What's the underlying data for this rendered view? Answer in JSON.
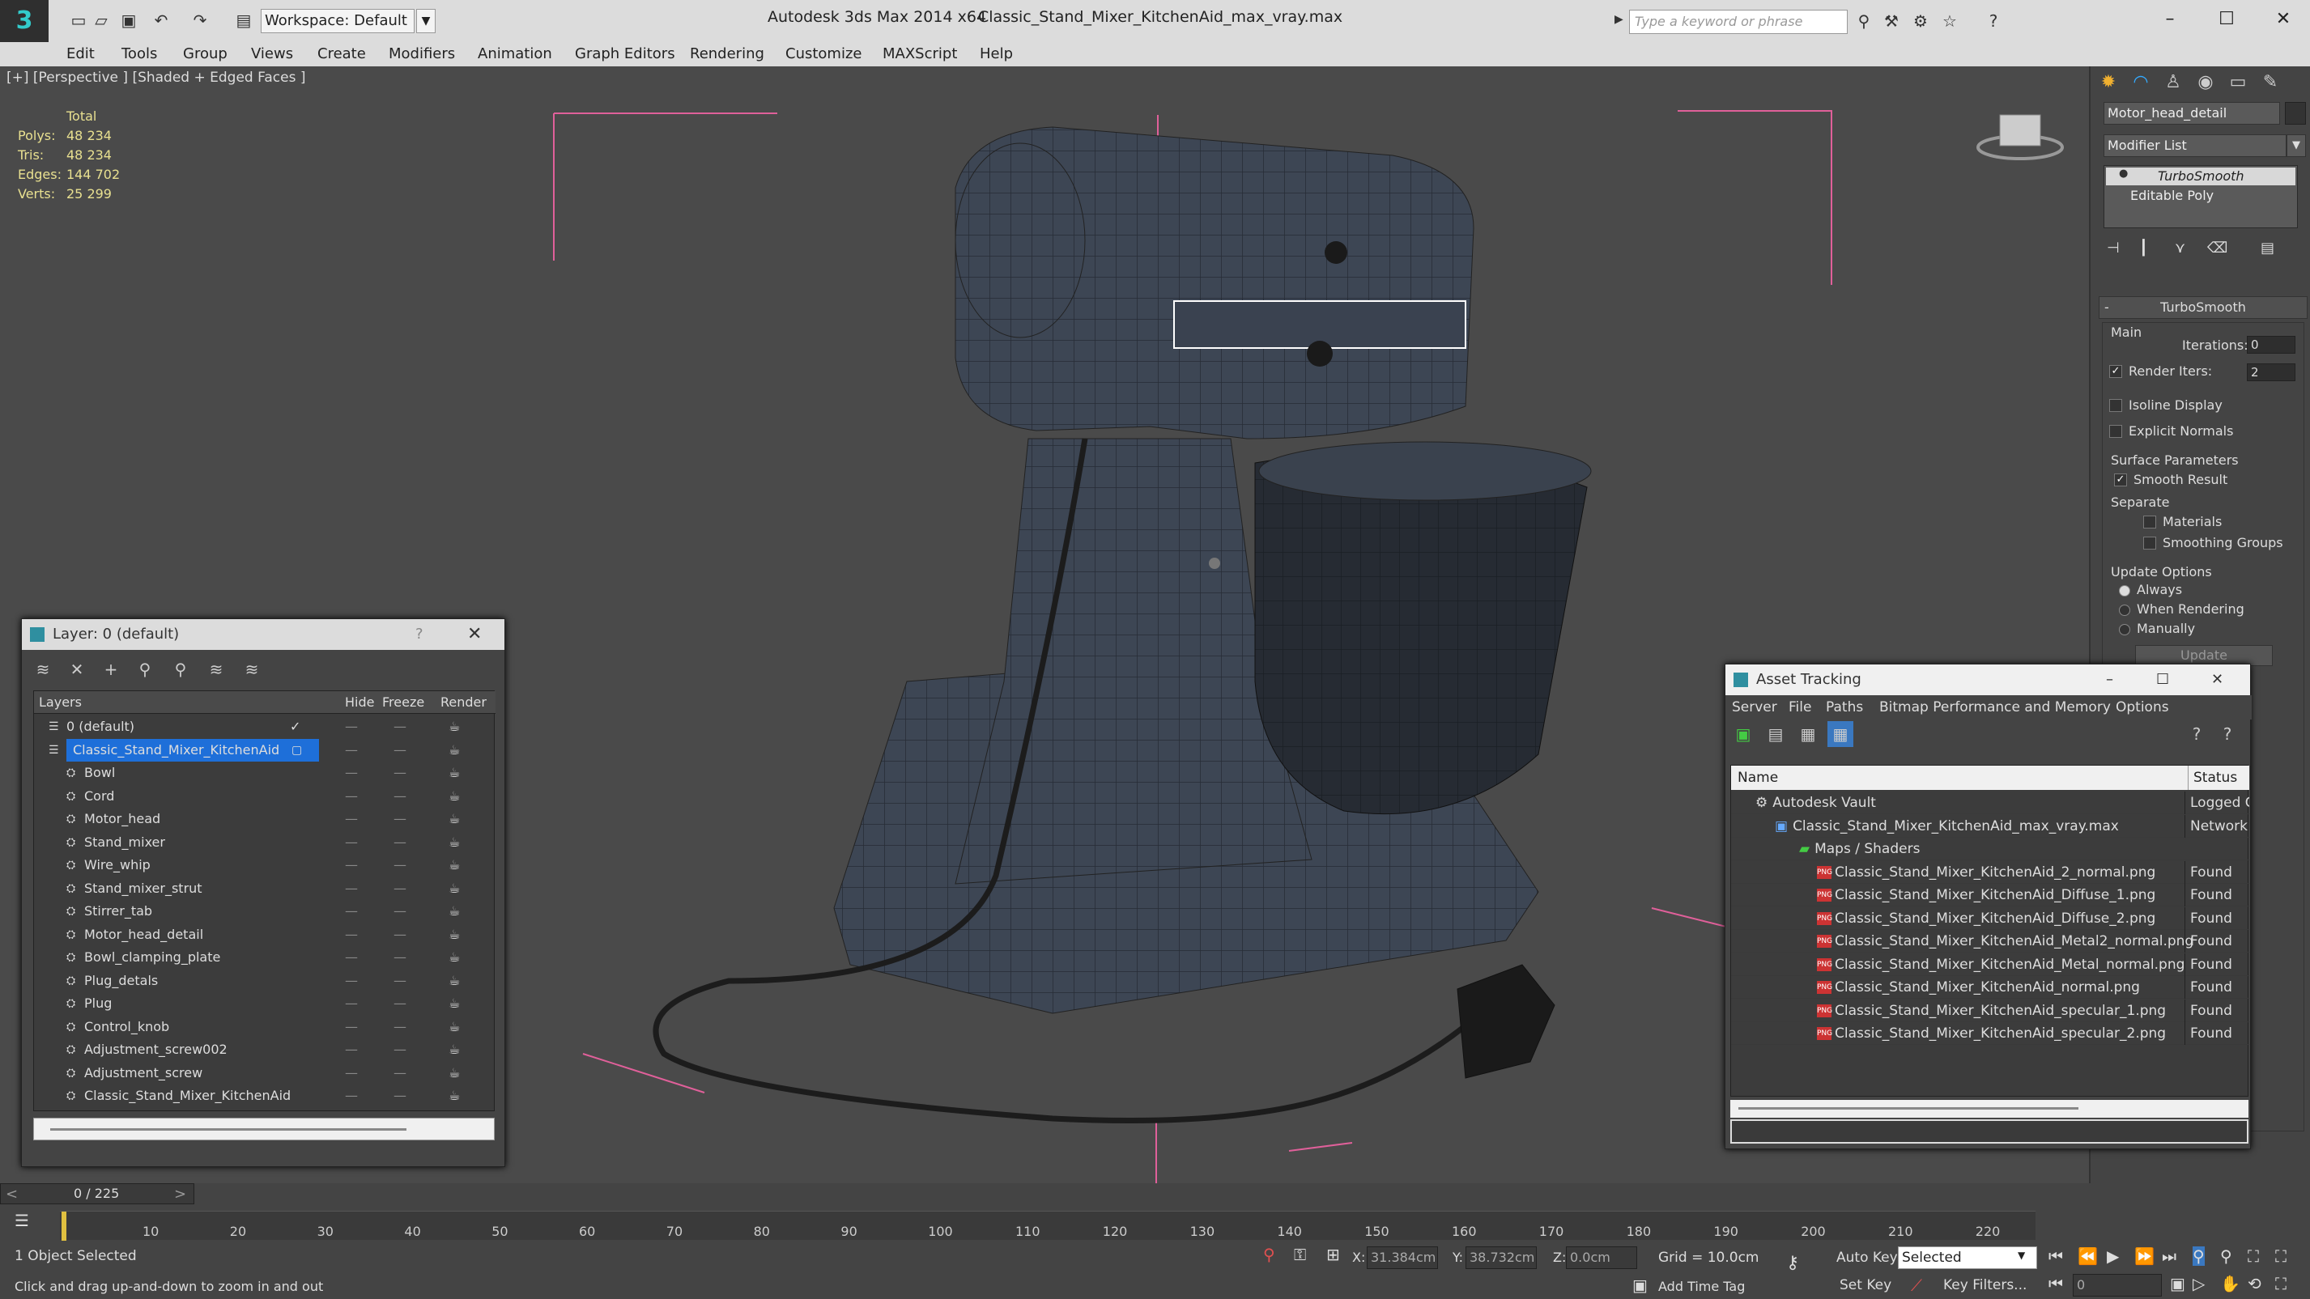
{
  "titlebar": {
    "workspace": "Workspace: Default",
    "app_title": "Autodesk 3ds Max  2014 x64",
    "doc_title": "Classic_Stand_Mixer_KitchenAid_max_vray.max",
    "search_placeholder": "Type a keyword or phrase"
  },
  "menu": [
    "Edit",
    "Tools",
    "Group",
    "Views",
    "Create",
    "Modifiers",
    "Animation",
    "Graph Editors",
    "Rendering",
    "Customize",
    "MAXScript",
    "Help"
  ],
  "viewport": {
    "label": "[+] [Perspective ] [Shaded + Edged Faces ]",
    "stats": {
      "total_label": "Total",
      "polys_label": "Polys:",
      "polys": "48 234",
      "tris_label": "Tris:",
      "tris": "48 234",
      "edges_label": "Edges:",
      "edges": "144 702",
      "verts_label": "Verts:",
      "verts": "25 299"
    }
  },
  "command_panel": {
    "object_name": "Motor_head_detail",
    "modifier_list": "Modifier List",
    "stack": [
      "TurboSmooth",
      "Editable Poly"
    ],
    "rollout_title": "TurboSmooth",
    "main_label": "Main",
    "iterations_label": "Iterations:",
    "iterations": "0",
    "render_iters_label": "Render Iters:",
    "render_iters": "2",
    "isoline": "Isoline Display",
    "explicit_normals": "Explicit Normals",
    "surface_params": "Surface Parameters",
    "smooth_result": "Smooth Result",
    "separate": "Separate",
    "materials": "Materials",
    "smoothing_groups": "Smoothing Groups",
    "update_options": "Update Options",
    "always": "Always",
    "when_rendering": "When Rendering",
    "manually": "Manually",
    "update_button": "Update"
  },
  "layer_window": {
    "title": "Layer: 0 (default)",
    "help": "?",
    "columns": {
      "layers": "Layers",
      "hide": "Hide",
      "freeze": "Freeze",
      "render": "Render"
    },
    "rows": [
      {
        "name": "0 (default)",
        "level": 0
      },
      {
        "name": "Classic_Stand_Mixer_KitchenAid",
        "level": 0
      },
      {
        "name": "Bowl",
        "level": 1
      },
      {
        "name": "Cord",
        "level": 1
      },
      {
        "name": "Motor_head",
        "level": 1
      },
      {
        "name": "Stand_mixer",
        "level": 1
      },
      {
        "name": "Wire_whip",
        "level": 1
      },
      {
        "name": "Stand_mixer_strut",
        "level": 1
      },
      {
        "name": "Stirrer_tab",
        "level": 1
      },
      {
        "name": "Motor_head_detail",
        "level": 1
      },
      {
        "name": "Bowl_clamping_plate",
        "level": 1
      },
      {
        "name": "Plug_detals",
        "level": 1
      },
      {
        "name": "Plug",
        "level": 1
      },
      {
        "name": "Control_knob",
        "level": 1
      },
      {
        "name": "Adjustment_screw002",
        "level": 1
      },
      {
        "name": "Adjustment_screw",
        "level": 1
      },
      {
        "name": "Classic_Stand_Mixer_KitchenAid",
        "level": 1
      }
    ]
  },
  "asset_window": {
    "title": "Asset Tracking",
    "menus": [
      "Server",
      "File",
      "Paths",
      "Bitmap Performance and Memory",
      "Options"
    ],
    "columns": {
      "name": "Name",
      "status": "Status"
    },
    "rows": [
      {
        "name": "Autodesk Vault",
        "status": "Logged C",
        "level": 0
      },
      {
        "name": "Classic_Stand_Mixer_KitchenAid_max_vray.max",
        "status": "Network I",
        "level": 1
      },
      {
        "name": "Maps / Shaders",
        "status": "",
        "level": 2
      },
      {
        "name": "Classic_Stand_Mixer_KitchenAid_2_normal.png",
        "status": "Found",
        "level": 3
      },
      {
        "name": "Classic_Stand_Mixer_KitchenAid_Diffuse_1.png",
        "status": "Found",
        "level": 3
      },
      {
        "name": "Classic_Stand_Mixer_KitchenAid_Diffuse_2.png",
        "status": "Found",
        "level": 3
      },
      {
        "name": "Classic_Stand_Mixer_KitchenAid_Metal2_normal.png",
        "status": "Found",
        "level": 3
      },
      {
        "name": "Classic_Stand_Mixer_KitchenAid_Metal_normal.png",
        "status": "Found",
        "level": 3
      },
      {
        "name": "Classic_Stand_Mixer_KitchenAid_normal.png",
        "status": "Found",
        "level": 3
      },
      {
        "name": "Classic_Stand_Mixer_KitchenAid_specular_1.png",
        "status": "Found",
        "level": 3
      },
      {
        "name": "Classic_Stand_Mixer_KitchenAid_specular_2.png",
        "status": "Found",
        "level": 3
      }
    ]
  },
  "timeline": {
    "frame_label": "0 / 225",
    "ticks": [
      "10",
      "20",
      "30",
      "40",
      "50",
      "60",
      "70",
      "80",
      "90",
      "100",
      "110",
      "120",
      "130",
      "140",
      "150",
      "160",
      "170",
      "180",
      "190",
      "200",
      "210",
      "220"
    ]
  },
  "status": {
    "selected": "1 Object Selected",
    "prompt": "Click and drag up-and-down to zoom in and out",
    "x_label": "X:",
    "x": "31.384cm",
    "y_label": "Y:",
    "y": "38.732cm",
    "z_label": "Z:",
    "z": "0.0cm",
    "grid": "Grid = 10.0cm",
    "auto_key": "Auto Key",
    "set_key": "Set Key",
    "selected_dropdown": "Selected",
    "key_filters": "Key Filters...",
    "add_time_tag": "Add Time Tag",
    "frame": "0"
  },
  "colors": {
    "accent": "#3399ff",
    "selection": "#1e6fd9",
    "found": "#dddddd",
    "stats": "#e8e090"
  }
}
